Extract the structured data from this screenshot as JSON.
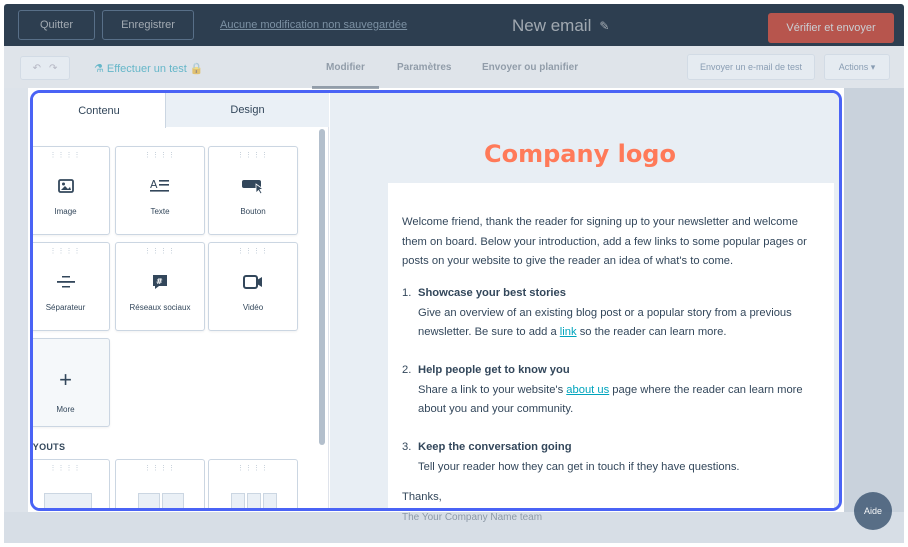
{
  "topbar": {
    "quit_label": "Quitter",
    "save_label": "Enregistrer",
    "status_text": "Aucune modification non sauvegardée",
    "email_title": "New email",
    "verify_send_label": "Vérifier et envoyer"
  },
  "subbar": {
    "test_label": "Effectuer un test",
    "tabs": [
      "Modifier",
      "Paramètres",
      "Envoyer ou planifier"
    ],
    "send_test_label": "Envoyer un e-mail de test",
    "actions_label": "Actions"
  },
  "panel": {
    "tabs": [
      "Contenu",
      "Design"
    ],
    "blocks": [
      "Image",
      "Texte",
      "Bouton",
      "Séparateur",
      "Réseaux sociaux",
      "Vidéo",
      "More"
    ],
    "layouts_title": "LAYOUTS",
    "layout_labels": [
      "1",
      "2",
      "3"
    ]
  },
  "preview": {
    "logo": "Company logo",
    "intro": "Welcome friend, thank the reader for signing up to your newsletter and welcome them on board. Below your introduction, add a few links to some popular pages or posts on your website to give the reader an idea of what's to come.",
    "items": [
      {
        "num": "1.",
        "title": "Showcase your best stories",
        "text_before": "Give an overview of an existing blog post or a popular story from a previous newsletter. Be sure to add a ",
        "link": "link",
        "text_after": " so the reader can learn more."
      },
      {
        "num": "2.",
        "title": "Help people get to know you",
        "text_before": "Share a link to your website's ",
        "link": "about us",
        "text_after": " page where the reader can learn more about you and your community."
      },
      {
        "num": "3.",
        "title": "Keep the conversation going",
        "text_before": "Tell your reader how they can get in touch if they have questions.",
        "link": "",
        "text_after": ""
      }
    ],
    "thanks": "Thanks,",
    "signature": "The Your Company Name team"
  },
  "help_label": "Aide",
  "colors": {
    "accent": "#ff7a59",
    "focus_border": "#4a63f5",
    "topbar": "#2d3e50",
    "link": "#00a4bd"
  }
}
